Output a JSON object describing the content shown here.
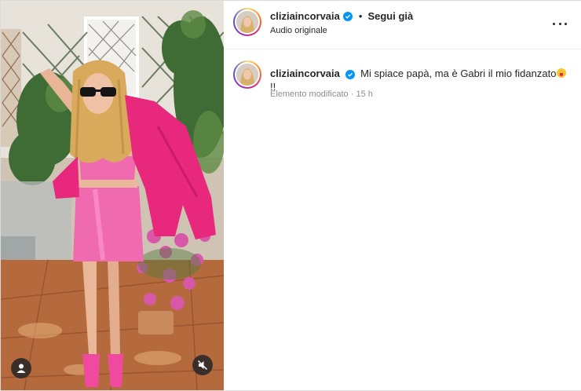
{
  "post": {
    "username": "cliziaincorvaia",
    "follow_status": "Segui già",
    "audio": "Audio originale",
    "separator": "•"
  },
  "comment": {
    "username": "cliziaincorvaia",
    "text": "Mi spiace papà, ma è Gabri il mio fidanzato",
    "suffix": "!!",
    "emoji": "tongue-out-face",
    "edited_label": "Elemento modificato",
    "dot": "·",
    "time": "15 h"
  },
  "icons": {
    "verified": "verified-badge-icon",
    "more": "more-options-icon",
    "tag": "user-tag-icon",
    "mute": "muted-speaker-icon"
  },
  "colors": {
    "verified_blue": "#0095f6",
    "outfit_pink": "#f2389a",
    "muted_text": "#8e8e8e"
  }
}
